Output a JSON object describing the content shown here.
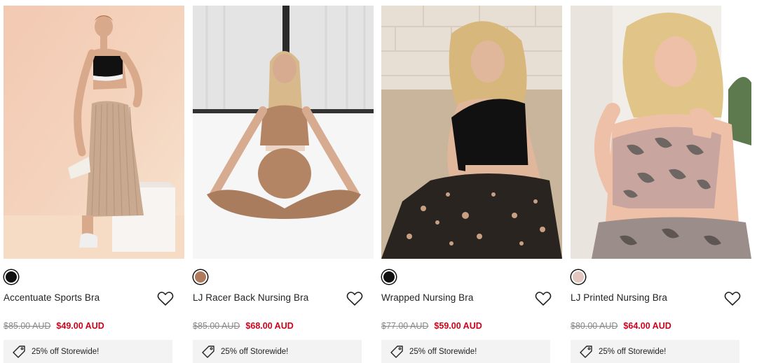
{
  "products": [
    {
      "name": "Accentuate Sports Bra",
      "was_price": "$85.00 AUD",
      "sale_price": "$49.00 AUD",
      "swatch_color": "#111111",
      "promo": "25% off Storewide!"
    },
    {
      "name": "LJ Racer Back Nursing Bra",
      "was_price": "$85.00 AUD",
      "sale_price": "$68.00 AUD",
      "swatch_color": "#b07a5e",
      "promo": "25% off Storewide!"
    },
    {
      "name": "Wrapped Nursing Bra",
      "was_price": "$77.00 AUD",
      "sale_price": "$59.00 AUD",
      "swatch_color": "#111111",
      "promo": "25% off Storewide!"
    },
    {
      "name": "LJ Printed Nursing Bra",
      "was_price": "$80.00 AUD",
      "sale_price": "$64.00 AUD",
      "swatch_color": "#e2c6bf",
      "promo": "25% off Storewide!"
    }
  ],
  "icons": {
    "wishlist": "heart-outline-icon",
    "promo": "price-tag-icon"
  },
  "colors": {
    "sale": "#d0021b",
    "was": "#888888",
    "promo_bg": "#f3f3f3"
  }
}
